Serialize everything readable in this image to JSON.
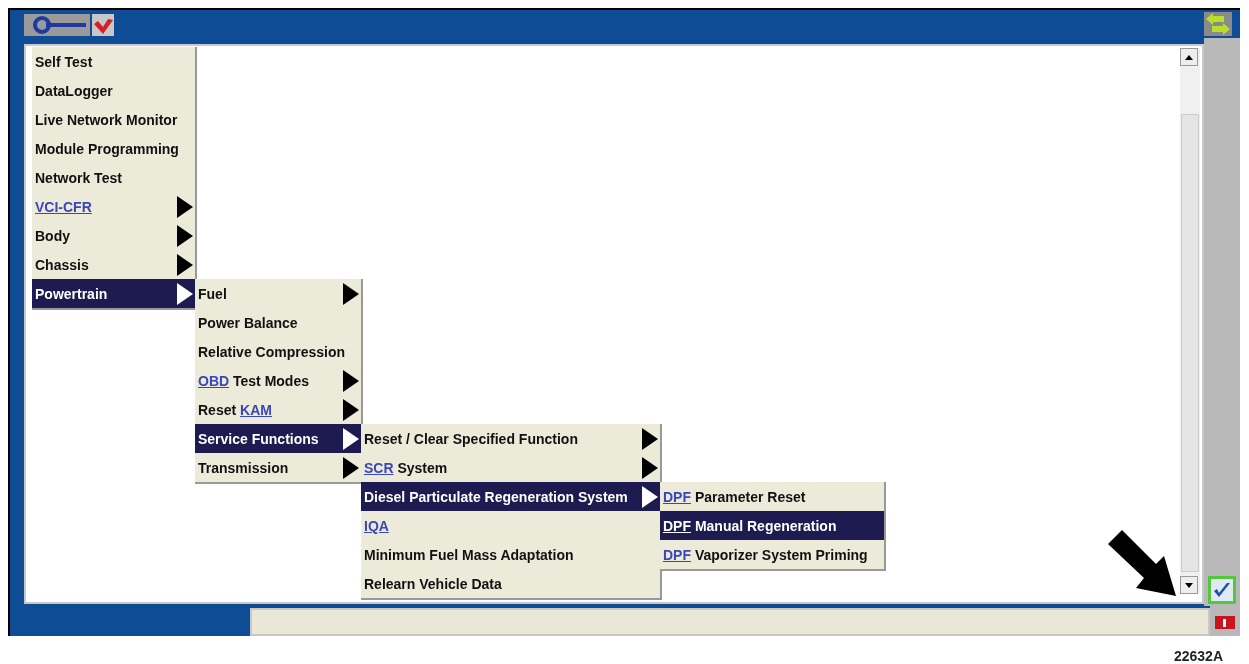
{
  "menu": {
    "items": [
      {
        "label": "Self Test",
        "selected": false
      },
      {
        "label": "DataLogger",
        "selected": false
      },
      {
        "label": "Live Network Monitor",
        "selected": false
      },
      {
        "label": "Module Programming",
        "selected": false
      },
      {
        "label": "Network Test",
        "selected": false
      },
      {
        "link": "VCI-CFR",
        "selected": false,
        "has_submenu": true
      },
      {
        "label": "Body",
        "selected": false,
        "has_submenu": true
      },
      {
        "label": "Chassis",
        "selected": false,
        "has_submenu": true
      },
      {
        "label": "Powertrain",
        "selected": true,
        "has_submenu": true,
        "children": [
          {
            "label": "Fuel",
            "selected": false,
            "has_submenu": true
          },
          {
            "label": "Power Balance",
            "selected": false
          },
          {
            "label": "Relative Compression",
            "selected": false
          },
          {
            "link": "OBD",
            "label": "Test Modes",
            "selected": false,
            "has_submenu": true
          },
          {
            "label": "Reset",
            "link_after": "KAM",
            "selected": false,
            "has_submenu": true
          },
          {
            "label": "Service Functions",
            "selected": true,
            "has_submenu": true,
            "children": [
              {
                "label": "Reset / Clear Specified Function",
                "selected": false,
                "has_submenu": true
              },
              {
                "link": "SCR",
                "label": "System",
                "selected": false,
                "has_submenu": true
              },
              {
                "label": "Diesel Particulate Regeneration System",
                "selected": true,
                "has_submenu": true,
                "children": [
                  {
                    "link": "DPF",
                    "label": "Parameter Reset",
                    "selected": false
                  },
                  {
                    "link": "DPF",
                    "label": "Manual Regeneration",
                    "selected": true
                  },
                  {
                    "link": "DPF",
                    "label": "Vaporizer System Priming",
                    "selected": false
                  }
                ]
              },
              {
                "link": "IQA",
                "selected": false
              },
              {
                "label": "Minimum Fuel Mass Adaptation",
                "selected": false
              },
              {
                "label": "Relearn Vehicle Data",
                "selected": false
              }
            ]
          },
          {
            "label": "Transmission",
            "selected": false,
            "has_submenu": true
          }
        ]
      }
    ]
  },
  "figure_number": "22632A"
}
